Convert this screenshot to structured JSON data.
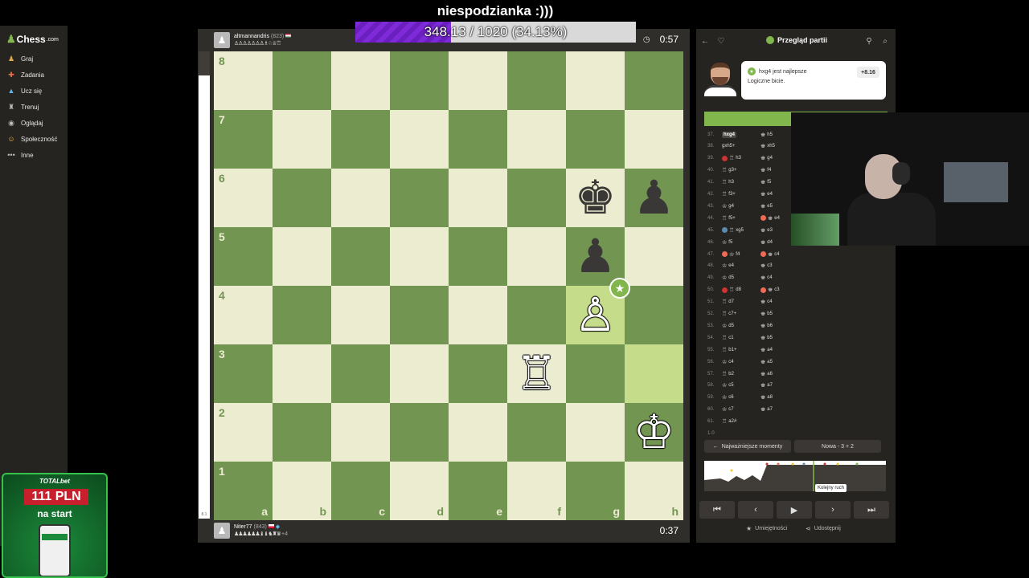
{
  "stream": {
    "title": "niespodzianka :)))",
    "sub_progress_text": "348.13 / 1020 (34.13%)",
    "sub_progress_percent": 34.13
  },
  "sidebar": {
    "logo_text": "Chess",
    "logo_tld": ".com",
    "items": [
      {
        "label": "Graj",
        "icon": "play-pawn-icon"
      },
      {
        "label": "Zadania",
        "icon": "puzzle-icon"
      },
      {
        "label": "Ucz się",
        "icon": "learn-icon"
      },
      {
        "label": "Trenuj",
        "icon": "train-icon"
      },
      {
        "label": "Oglądaj",
        "icon": "watch-icon"
      },
      {
        "label": "Społeczność",
        "icon": "community-icon"
      },
      {
        "label": "Inne",
        "icon": "more-icon"
      }
    ]
  },
  "top_player": {
    "name": "altmannandris",
    "rating": "(823)",
    "captured": "♙♙♙♙♙♙♙♗♘♕♖",
    "clock": "0:57"
  },
  "bottom_player": {
    "name": "Niter77",
    "rating": "(843)",
    "captured": "♟♟♟♟♟♟♝♝♞♜♛",
    "advantage": "+4",
    "clock": "0:37"
  },
  "board": {
    "ranks": [
      "8",
      "7",
      "6",
      "5",
      "4",
      "3",
      "2",
      "1"
    ],
    "files": [
      "a",
      "b",
      "c",
      "d",
      "e",
      "f",
      "g",
      "h"
    ],
    "pieces": [
      {
        "square": "g6",
        "glyph": "♚",
        "color": "black",
        "name": "black-king"
      },
      {
        "square": "h6",
        "glyph": "♟",
        "color": "black",
        "name": "black-pawn"
      },
      {
        "square": "g5",
        "glyph": "♟",
        "color": "black",
        "name": "black-pawn"
      },
      {
        "square": "g4",
        "glyph": "♙",
        "color": "white",
        "name": "white-pawn"
      },
      {
        "square": "f3",
        "glyph": "♖",
        "color": "white",
        "name": "white-rook"
      },
      {
        "square": "h2",
        "glyph": "♔",
        "color": "white",
        "name": "white-king"
      }
    ],
    "highlight_squares": [
      "g4",
      "h3"
    ],
    "best_move_square": "g4"
  },
  "review": {
    "title": "Przegląd partii",
    "bubble_move": "hxg4 jest najlepsze",
    "bubble_comment": "Logiczne bicie.",
    "eval": "+8.16",
    "moves": [
      {
        "n": "37.",
        "w": "hxg4",
        "b": "h5",
        "wsym": "",
        "bsym": "♚",
        "wcur": true
      },
      {
        "n": "38.",
        "w": "gxh5+",
        "b": "xh5",
        "wsym": "",
        "bsym": "♚"
      },
      {
        "n": "39.",
        "w": "h3",
        "b": "g4",
        "wsym": "♖",
        "bsym": "♚",
        "wflag": "blunder"
      },
      {
        "n": "40.",
        "w": "g3+",
        "b": "f4",
        "wsym": "♖",
        "bsym": "♚"
      },
      {
        "n": "41.",
        "w": "h3",
        "b": "f5",
        "wsym": "♖",
        "bsym": "♚"
      },
      {
        "n": "42.",
        "w": "f3+",
        "b": "e4",
        "wsym": "♖",
        "bsym": "♚"
      },
      {
        "n": "43.",
        "w": "g4",
        "b": "e5",
        "wsym": "♔",
        "bsym": "♚"
      },
      {
        "n": "44.",
        "w": "f5+",
        "b": "e4",
        "wsym": "♖",
        "bsym": "♚",
        "bflag": "miss"
      },
      {
        "n": "45.",
        "w": "xg5",
        "b": "e3",
        "wsym": "♖",
        "bsym": "♚",
        "wflag": "brill"
      },
      {
        "n": "46.",
        "w": "f5",
        "b": "d4",
        "wsym": "♔",
        "bsym": "♚"
      },
      {
        "n": "47.",
        "w": "f4",
        "b": "c4",
        "wsym": "♔",
        "bsym": "♚",
        "wflag": "miss",
        "bflag": "miss"
      },
      {
        "n": "48.",
        "w": "e4",
        "b": "c3",
        "wsym": "♔",
        "bsym": "♚"
      },
      {
        "n": "49.",
        "w": "d5",
        "b": "c4",
        "wsym": "♔",
        "bsym": "♚"
      },
      {
        "n": "50.",
        "w": "d8",
        "b": "c3",
        "wsym": "♖",
        "bsym": "♚",
        "wflag": "blunder",
        "bflag": "miss"
      },
      {
        "n": "51.",
        "w": "d7",
        "b": "c4",
        "wsym": "♖",
        "bsym": "♚"
      },
      {
        "n": "52.",
        "w": "c7+",
        "b": "b5",
        "wsym": "♖",
        "bsym": "♚"
      },
      {
        "n": "53.",
        "w": "d5",
        "b": "b6",
        "wsym": "♔",
        "bsym": "♚"
      },
      {
        "n": "54.",
        "w": "c1",
        "b": "b5",
        "wsym": "♖",
        "bsym": "♚"
      },
      {
        "n": "55.",
        "w": "b1+",
        "b": "a4",
        "wsym": "♖",
        "bsym": "♚"
      },
      {
        "n": "56.",
        "w": "c4",
        "b": "a5",
        "wsym": "♔",
        "bsym": "♚"
      },
      {
        "n": "57.",
        "w": "b2",
        "b": "a6",
        "wsym": "♖",
        "bsym": "♚"
      },
      {
        "n": "58.",
        "w": "c5",
        "b": "a7",
        "wsym": "♔",
        "bsym": "♚"
      },
      {
        "n": "59.",
        "w": "c6",
        "b": "a8",
        "wsym": "♔",
        "bsym": "♚"
      },
      {
        "n": "60.",
        "w": "c7",
        "b": "a7",
        "wsym": "♔",
        "bsym": "♚"
      },
      {
        "n": "61.",
        "w": "a2#",
        "b": "",
        "wsym": "♖",
        "bsym": ""
      },
      {
        "n": "1-0",
        "w": "",
        "b": "",
        "wsym": "",
        "bsym": ""
      }
    ],
    "key_moments_label": "Najważniejsze momenty",
    "new_game_label": "Nowa - 3 + 2",
    "tooltip": "Kolejny ruch",
    "skills_label": "Umiejętności",
    "share_label": "Udostępnij"
  },
  "ad": {
    "brand": "TOTALbet",
    "amount": "111 PLN",
    "tagline": "na start"
  },
  "colors": {
    "board_light": "#ebecd0",
    "board_dark": "#739552",
    "accent_green": "#81b64c",
    "sub_bar_purple": "#7e2ad9"
  }
}
